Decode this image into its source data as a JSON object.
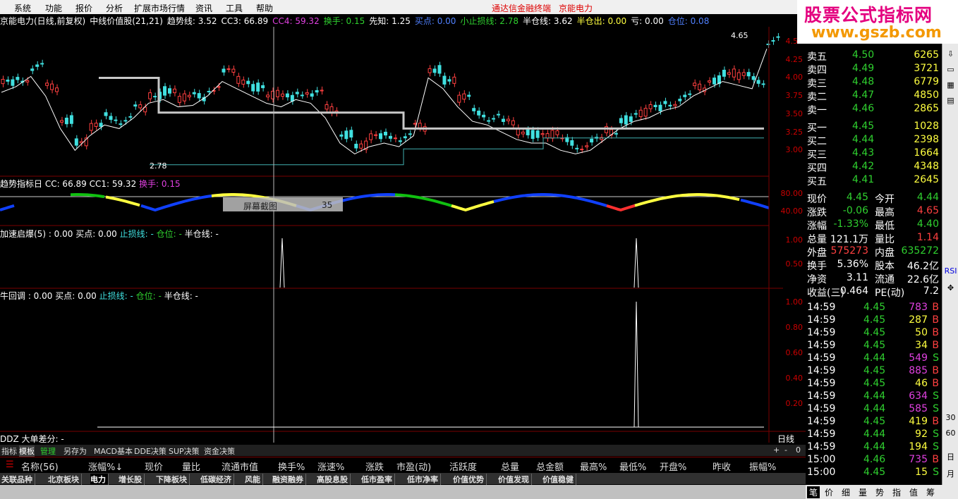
{
  "menu": [
    "系统",
    "功能",
    "报价",
    "分析",
    "扩展市场行情",
    "资讯",
    "工具",
    "帮助"
  ],
  "window": {
    "app_title": "通达信金融终端",
    "stock_title": "京能电力"
  },
  "logo": {
    "line1": "股票公式指标网",
    "line2": "www.gszb.com"
  },
  "main": {
    "header": "京能电力(日线,前复权)",
    "indicator": "中线价值股(21,21)",
    "vals": [
      "趋势线: 3.52",
      "CC3: 66.89",
      "CC4: 59.32",
      "换手: 0.15",
      "先知: 1.25",
      "买点: 0.00",
      "小止损线: 2.78",
      "半仓线: 3.62",
      "半仓出: 0.00",
      "亏: 0.00",
      "仓位: 0.08"
    ]
  },
  "price": {
    "axis": [
      "4.50",
      "4.25",
      "4.00",
      "3.75",
      "3.50",
      "3.25",
      "3.00"
    ],
    "high_label": "4.65",
    "low_label": "2.78"
  },
  "tooltip": {
    "label": "屏幕截图",
    "value": "35"
  },
  "ind1": {
    "label": "趋势指标日 CC: 66.89 CC1: 59.32",
    "extra": "换手: 0.15",
    "axis": [
      "80.00",
      "40.00"
    ]
  },
  "ind2": {
    "a": "加速启爆(5) : 0.00 买点: 0.00",
    "b": "止损线: -",
    "c": "仓位: -",
    "d": "半仓线: -",
    "axis": [
      "1.00",
      "0.50"
    ]
  },
  "ind3": {
    "a": "牛回调 : 0.00 买点: 0.00",
    "b": "止损线: -",
    "c": "仓位: -",
    "d": "半仓线: -",
    "axis": [
      "1.00",
      "0.80",
      "0.60",
      "0.40",
      "0.20"
    ]
  },
  "ddz": {
    "label": "DDZ 大单差分: -",
    "period": "日线"
  },
  "tabs": [
    "指标",
    "模板",
    "管理",
    "另存为",
    "MACD基本",
    "DDE决策",
    "SUP决策",
    "资金决策",
    "+",
    "-",
    "0"
  ],
  "cols": [
    "名称(56)",
    "涨幅%↓",
    "现价",
    "量比",
    "流通市值",
    "换手%",
    "涨速%",
    "涨跌",
    "市盈(动)",
    "活跃度",
    "总量",
    "总金额",
    "最高%",
    "最低%",
    "开盘%",
    "昨收",
    "振幅%"
  ],
  "sectors": [
    "关联品种",
    "北京板块",
    "电力",
    "增长股",
    "下降板块",
    "低碳经济",
    "风能",
    "融资融券",
    "高股息股",
    "低市盈率",
    "低市净率",
    "价值优势",
    "价值发现",
    "价值稳健"
  ],
  "quote": {
    "asks": [
      [
        "卖五",
        "4.50",
        "6265"
      ],
      [
        "卖四",
        "4.49",
        "3721"
      ],
      [
        "卖三",
        "4.48",
        "6779"
      ],
      [
        "卖二",
        "4.47",
        "4850"
      ],
      [
        "卖一",
        "4.46",
        "2865"
      ]
    ],
    "bids": [
      [
        "买一",
        "4.45",
        "1028"
      ],
      [
        "买二",
        "4.44",
        "2398"
      ],
      [
        "买三",
        "4.43",
        "1664"
      ],
      [
        "买四",
        "4.42",
        "4348"
      ],
      [
        "买五",
        "4.41",
        "2645"
      ]
    ],
    "stats": [
      [
        "现价",
        "4.45",
        "今开",
        "4.44"
      ],
      [
        "涨跌",
        "-0.06",
        "最高",
        "4.65"
      ],
      [
        "涨幅",
        "-1.33%",
        "最低",
        "4.40"
      ],
      [
        "总量",
        "121.1万",
        "量比",
        "1.14"
      ],
      [
        "外盘",
        "575273",
        "内盘",
        "635272"
      ],
      [
        "换手",
        "5.36%",
        "股本",
        "46.2亿"
      ],
      [
        "净资",
        "3.11",
        "流通",
        "22.6亿"
      ],
      [
        "收益(三)",
        "0.464",
        "PE(动)",
        "7.2"
      ]
    ],
    "ticks": [
      [
        "14:59",
        "4.45",
        "783",
        "B"
      ],
      [
        "14:59",
        "4.45",
        "287",
        "B"
      ],
      [
        "14:59",
        "4.45",
        "50",
        "B"
      ],
      [
        "14:59",
        "4.45",
        "34",
        "B"
      ],
      [
        "14:59",
        "4.44",
        "549",
        "S"
      ],
      [
        "14:59",
        "4.45",
        "885",
        "B"
      ],
      [
        "14:59",
        "4.45",
        "46",
        "B"
      ],
      [
        "14:59",
        "4.44",
        "634",
        "S"
      ],
      [
        "14:59",
        "4.44",
        "585",
        "S"
      ],
      [
        "14:59",
        "4.45",
        "419",
        "B"
      ],
      [
        "14:59",
        "4.44",
        "92",
        "S"
      ],
      [
        "14:59",
        "4.44",
        "194",
        "S"
      ],
      [
        "15:00",
        "4.46",
        "735",
        "B"
      ],
      [
        "15:00",
        "4.45",
        "15",
        "S"
      ]
    ]
  },
  "side": [
    "30",
    "60",
    "日",
    "月"
  ],
  "btabs": [
    "笔",
    "价",
    "细",
    "量",
    "势",
    "指",
    "值",
    "筹"
  ],
  "chart_data": {
    "type": "line",
    "price_range": [
      2.78,
      4.65
    ],
    "series": [
      {
        "name": "趋势线",
        "y": [
          3.9,
          3.98,
          4.12,
          3.85,
          3.4,
          3.1,
          3.3,
          3.45,
          3.4,
          3.55,
          3.75,
          3.8,
          3.7,
          3.72,
          3.85,
          4.05,
          3.95,
          3.85,
          3.75,
          3.7,
          3.8,
          3.75,
          3.55,
          3.2,
          3.05,
          3.15,
          3.2,
          3.15,
          3.3,
          4.1,
          3.95,
          3.7,
          3.5,
          3.45,
          3.35,
          3.25,
          3.2,
          3.2,
          3.1,
          3.05,
          3.1,
          3.25,
          3.4,
          3.5,
          3.55,
          3.65,
          3.7,
          3.85,
          3.95,
          4.05,
          4.0,
          3.95,
          4.5
        ]
      }
    ]
  }
}
